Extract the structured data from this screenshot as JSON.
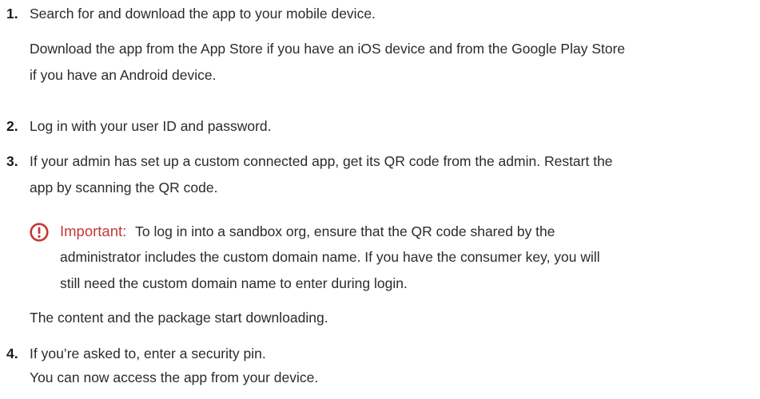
{
  "steps": [
    {
      "number": "1.",
      "main": "Search for and download the app to your mobile device.",
      "detail_line1": "Download the app from the App Store if you have an iOS device and from the Google Play Store",
      "detail_line2": "if you have an Android device."
    },
    {
      "number": "2.",
      "main": "Log in with your user ID and password."
    },
    {
      "number": "3.",
      "main_line1": "If your admin has set up a custom connected app, get its QR code from the admin. Restart the",
      "main_line2": "app by scanning the QR code.",
      "note": {
        "icon": "important-icon",
        "label": "Important:",
        "line1": "To log in into a sandbox org, ensure that the QR code shared by the",
        "line2": "administrator includes the custom domain name. If you have the consumer key, you will",
        "line3": "still need the custom domain name to enter during login."
      },
      "after": "The content and the package start downloading."
    },
    {
      "number": "4.",
      "main": "If you’re asked to, enter a security pin.",
      "result": "You can now access the app from your device."
    }
  ],
  "colors": {
    "text": "#2b2b2b",
    "important": "#c23934"
  }
}
